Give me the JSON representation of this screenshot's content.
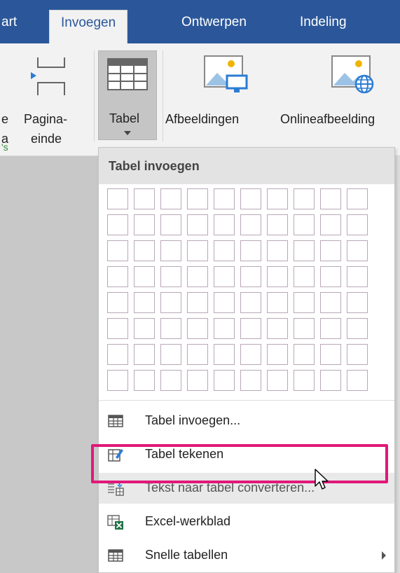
{
  "tabs": [
    {
      "label": "art"
    },
    {
      "label": "Invoegen",
      "active": true
    },
    {
      "label": "Ontwerpen"
    },
    {
      "label": "Indeling"
    }
  ],
  "ribbon": {
    "left_fragments": [
      "e",
      "a",
      "'s"
    ],
    "pagina_einde": {
      "line1": "Pagina-",
      "line2": "einde"
    },
    "tabel": {
      "label": "Tabel"
    },
    "afbeeldingen": {
      "label": "Afbeeldingen"
    },
    "onlineafbeeldingen": {
      "label": "Onlineafbeelding"
    }
  },
  "dropdown": {
    "header": "Tabel invoegen",
    "grid": {
      "columns": 10,
      "rows": 8
    },
    "items": [
      {
        "label": "Tabel invoegen...",
        "icon": "table-icon"
      },
      {
        "label": "Tabel tekenen",
        "icon": "draw-table-icon"
      },
      {
        "label": "Tekst naar tabel converteren...",
        "icon": "text-to-table-icon",
        "highlighted": true
      },
      {
        "label": "Excel-werkblad",
        "icon": "excel-icon"
      },
      {
        "label": "Snelle tabellen",
        "icon": "quick-tables-icon",
        "submenu": true
      }
    ]
  },
  "colors": {
    "tab_bar": "#2b579a",
    "highlight": "#e0197a",
    "group_label": "#3a8b3a"
  }
}
